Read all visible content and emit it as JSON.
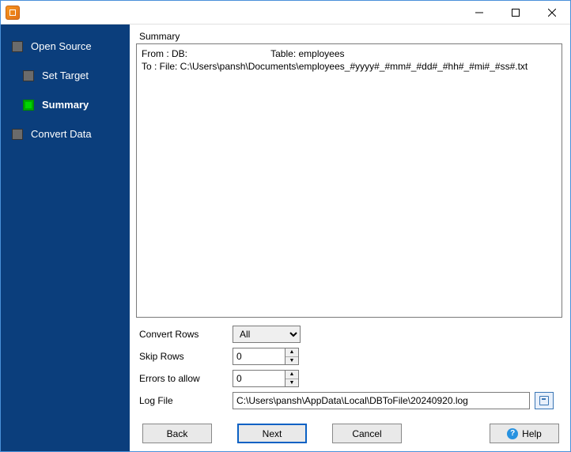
{
  "titlebar": {
    "app_title": ""
  },
  "sidebar": {
    "items": [
      {
        "label": "Open Source",
        "active": false
      },
      {
        "label": "Set Target",
        "active": false
      },
      {
        "label": "Summary",
        "active": true
      },
      {
        "label": "Convert Data",
        "active": false
      }
    ]
  },
  "main": {
    "panel_title": "Summary",
    "summary": {
      "from_db_label": "From : DB:",
      "table_label": "Table: employees",
      "to_line": "To : File: C:\\Users\\pansh\\Documents\\employees_#yyyy#_#mm#_#dd#_#hh#_#mi#_#ss#.txt"
    },
    "options": {
      "convert_rows": {
        "label": "Convert Rows",
        "value": "All"
      },
      "skip_rows": {
        "label": "Skip Rows",
        "value": "0"
      },
      "errors_to_allow": {
        "label": "Errors to allow",
        "value": "0"
      },
      "log_file": {
        "label": "Log File",
        "value": "C:\\Users\\pansh\\AppData\\Local\\DBToFile\\20240920.log"
      }
    }
  },
  "buttons": {
    "back": "Back",
    "next": "Next",
    "cancel": "Cancel",
    "help": "Help"
  }
}
